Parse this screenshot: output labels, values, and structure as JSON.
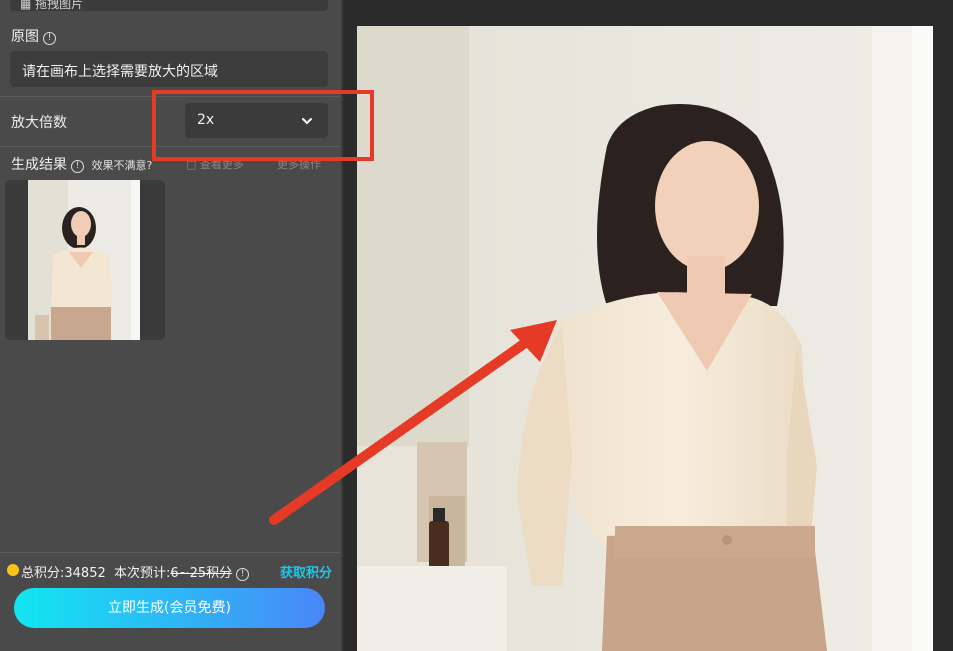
{
  "panel": {
    "top_stub_text": "▦ 拖拽图片",
    "original_label": "原图",
    "original_info": "!",
    "select_area_text": "请在画布上选择需要放大的区域",
    "scale_label": "放大倍数",
    "scale_value": "2x",
    "result_label": "生成结果",
    "result_info": "!",
    "result_hint": "效果不满意?",
    "faded_left": "□ 查看更多",
    "faded_right": "更多操作"
  },
  "footer": {
    "total_points": "总积分:34852",
    "estimate_label": "本次预计:",
    "estimate_value": "6~25积分",
    "estimate_info": "!",
    "get_points": "获取积分",
    "generate_button": "立即生成(会员免费)"
  },
  "colors": {
    "panel_bg": "#4a4a4a",
    "accent": "#1ec7e6",
    "highlight": "#e53a26",
    "coin": "#f5c518"
  },
  "icons": [
    "info-icon",
    "chevron-down-icon",
    "coin-icon",
    "arrow-annotation"
  ]
}
